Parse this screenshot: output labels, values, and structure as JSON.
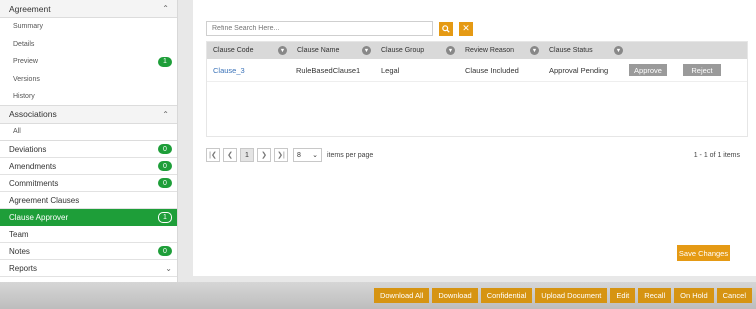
{
  "sidebar": {
    "agreement_group": "Agreement",
    "agreement_items": [
      {
        "label": "Summary",
        "badge": ""
      },
      {
        "label": "Details",
        "badge": ""
      },
      {
        "label": "Preview",
        "badge": "1"
      },
      {
        "label": "Versions",
        "badge": ""
      },
      {
        "label": "History",
        "badge": ""
      }
    ],
    "associations_group": "Associations",
    "associations_items": [
      {
        "label": "All"
      }
    ],
    "items": [
      {
        "label": "Deviations",
        "badge": "0"
      },
      {
        "label": "Amendments",
        "badge": "0"
      },
      {
        "label": "Commitments",
        "badge": "0"
      },
      {
        "label": "Agreement Clauses",
        "badge": ""
      },
      {
        "label": "Clause Approver",
        "badge": "1"
      },
      {
        "label": "Team",
        "badge": ""
      },
      {
        "label": "Notes",
        "badge": "0"
      },
      {
        "label": "Reports",
        "badge": ""
      }
    ]
  },
  "search": {
    "placeholder": "Refine Search Here..."
  },
  "grid": {
    "columns": [
      "Clause Code",
      "Clause Name",
      "Clause Group",
      "Review Reason",
      "Clause Status"
    ],
    "rows": [
      {
        "code": "Clause_3",
        "name": "RuleBasedClause1",
        "group": "Legal",
        "reason": "Clause Included",
        "status": "Approval Pending",
        "approve": "Approve",
        "reject": "Reject"
      }
    ]
  },
  "pager": {
    "current_page": "1",
    "page_size": "8",
    "items_per_page_label": "items per page",
    "info": "1 - 1 of 1 items"
  },
  "save_changes": "Save Changes",
  "toolbar": [
    "Download All",
    "Download",
    "Confidential",
    "Upload Document",
    "Edit",
    "Recall",
    "On Hold",
    "Cancel"
  ],
  "colors": {
    "accent": "#e59a14",
    "active": "#1e9e39",
    "link": "#3a72b8"
  }
}
